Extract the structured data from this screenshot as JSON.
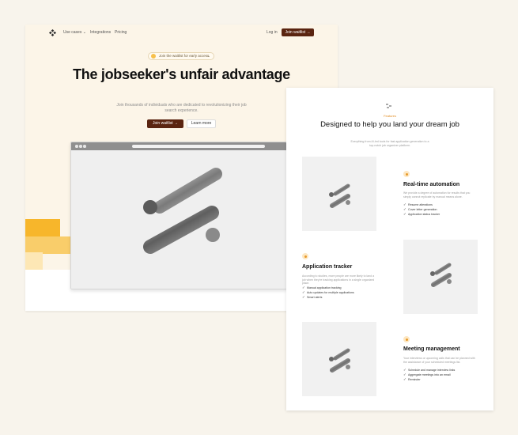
{
  "landing": {
    "nav": {
      "logo": "logo-icon",
      "links": [
        "Use cases",
        "Integrations",
        "Pricing"
      ],
      "login": "Log in",
      "cta": "Join waitlist →"
    },
    "badge": {
      "text": "Join the waitlist for early access",
      "arrow": "→"
    },
    "title": "The jobseeker's unfair advantage",
    "subtitle": "Join thousands of individuals who are dedicated to revolutionizing their job search experience.",
    "primary_button": "Join waitlist →",
    "secondary_button": "Learn more"
  },
  "features": {
    "eyebrow": "Features",
    "title": "Designed to help you land your dream job",
    "subtitle": "Everything from AI-led tools for fast application generation to a top-notch job organizer platform.",
    "items": [
      {
        "title": "Real-time automation",
        "description": "We provide a degree of automation for results that you simply cannot replicate by manual means alone.",
        "points": [
          "Resume alterations",
          "Cover letter generation",
          "Application status tracker"
        ]
      },
      {
        "title": "Application tracker",
        "description": "According to studies, more people are more likely to land a job when they're tracking applications in a single organized place.",
        "points": [
          "Manual application tracking",
          "Auto updates for multiple applications",
          "Smart alerts"
        ]
      },
      {
        "title": "Meeting management",
        "description": "Your interviews or upcoming calls that can be planned with the assistance of your scheduled meetings list.",
        "points": [
          "Schedule and manage interview links",
          "Aggregate meetings into an email",
          "Reminder"
        ]
      }
    ]
  },
  "colors": {
    "brand_dark": "#5a2410",
    "accent": "#f7b62b",
    "accent_text": "#e08a1e"
  }
}
